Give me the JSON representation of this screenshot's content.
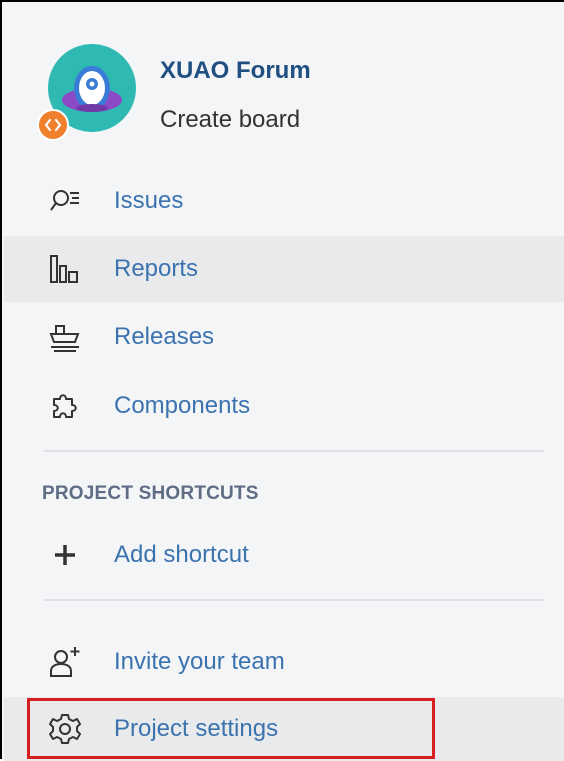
{
  "project": {
    "name": "XUAO Forum",
    "board_link": "Create board"
  },
  "nav": {
    "issues": "Issues",
    "reports": "Reports",
    "releases": "Releases",
    "components": "Components"
  },
  "shortcuts": {
    "heading": "PROJECT SHORTCUTS",
    "add": "Add shortcut"
  },
  "footer": {
    "invite": "Invite your team",
    "settings": "Project settings"
  },
  "colors": {
    "link": "#3b73af",
    "project_name": "#205081",
    "selected_bg": "#e9eaec",
    "highlight": "#d62020",
    "avatar_bg": "#2fb9b3",
    "avatar_saucer": "#8c4bc4",
    "badge": "#f0802c"
  },
  "icons": {
    "avatar": "ufo-avatar",
    "badge": "code-badge-icon",
    "issues": "issues-search-icon",
    "reports": "reports-bar-icon",
    "releases": "releases-ship-icon",
    "components": "components-puzzle-icon",
    "add": "plus-icon",
    "invite": "add-user-icon",
    "settings": "gear-icon"
  }
}
